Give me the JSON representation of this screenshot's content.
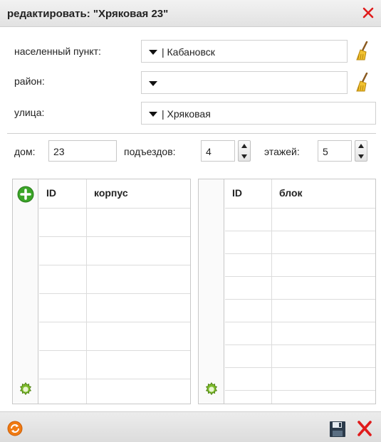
{
  "dialog": {
    "title": "редактировать: \"Хряковая 23\""
  },
  "form": {
    "locality_label": "населенный пункт:",
    "locality_value": "| Кабановск",
    "district_label": "район:",
    "district_value": "",
    "street_label": "улица:",
    "street_value": "| Хряковая",
    "house_label": "дом:",
    "house_value": "23",
    "entrances_label": "подъездов:",
    "entrances_value": "4",
    "floors_label": "этажей:",
    "floors_value": "5"
  },
  "buildings_table": {
    "columns": [
      "ID",
      "корпус"
    ],
    "rows": []
  },
  "blocks_table": {
    "columns": [
      "ID",
      "блок"
    ],
    "rows": []
  },
  "colors": {
    "close_red": "#e01b1b",
    "add_green": "#3aa527",
    "refresh_orange": "#f07a12"
  },
  "icons": [
    "close-icon",
    "broom-icon",
    "plus-icon",
    "gear-icon",
    "refresh-icon",
    "save-icon"
  ]
}
